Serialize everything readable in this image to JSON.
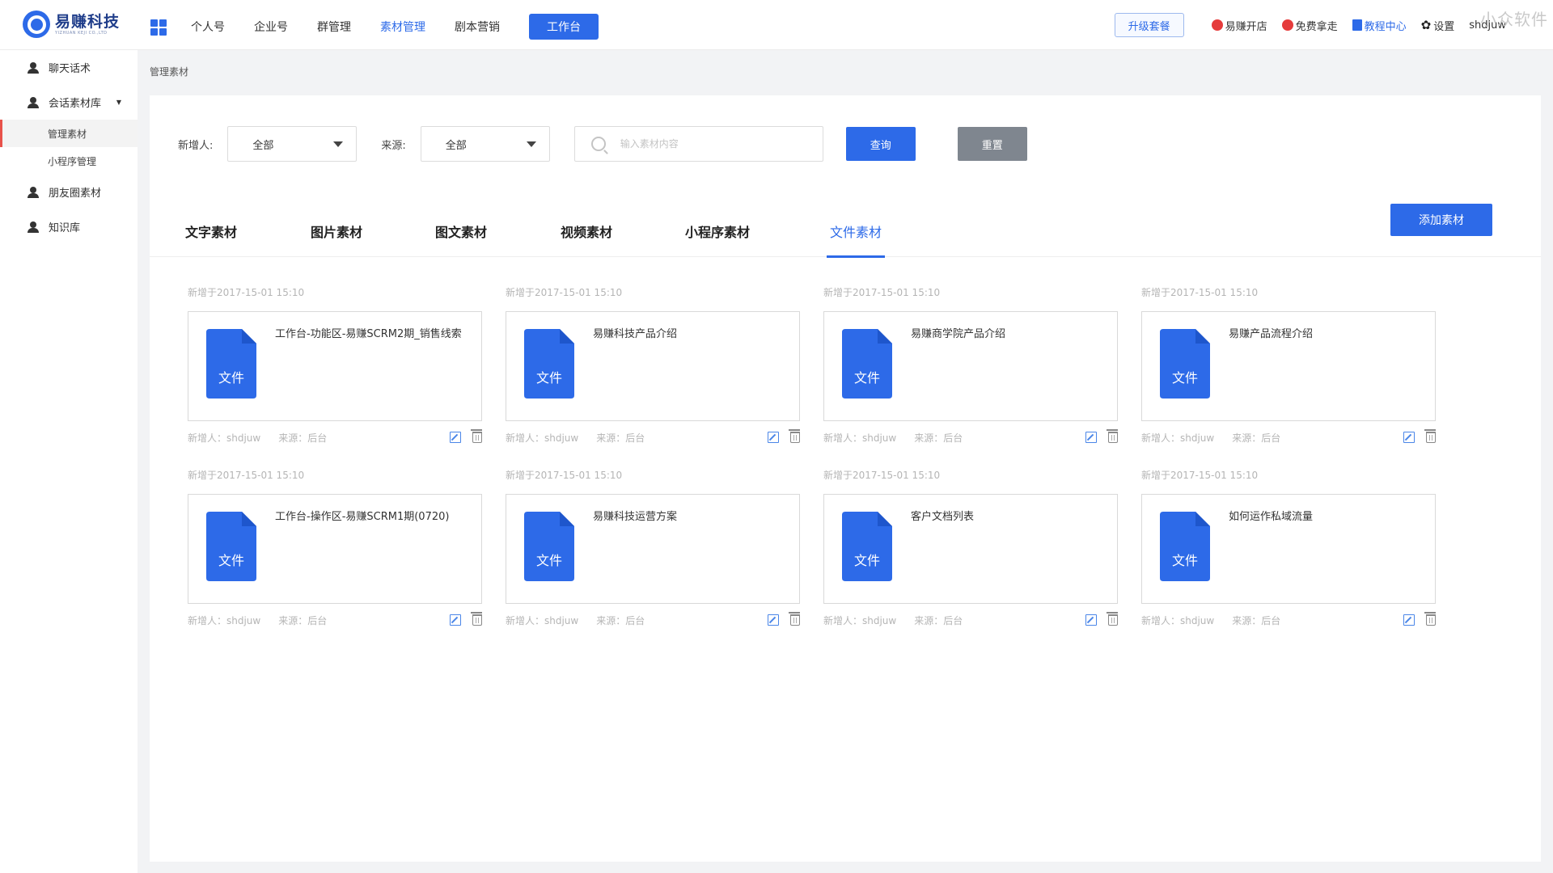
{
  "header": {
    "logo_name": "易赚科技",
    "logo_sub": "YIZHUAN KEJI CO.,LTD",
    "nav": [
      {
        "label": "个人号"
      },
      {
        "label": "企业号"
      },
      {
        "label": "群管理"
      },
      {
        "label": "素材管理",
        "active": true
      },
      {
        "label": "剧本营销"
      }
    ],
    "workbench_label": "工作台",
    "upgrade_label": "升级套餐",
    "tools": {
      "open_store": "易赚开店",
      "free_take": "免费拿走",
      "tutorial": "教程中心",
      "settings": "设置",
      "user": "shdjuw"
    },
    "watermark": "小众软件",
    "accent_color": "#2d6ae8"
  },
  "sidebar": {
    "items": [
      {
        "label": "聊天话术"
      },
      {
        "label": "会话素材库"
      },
      {
        "label": "管理素材"
      },
      {
        "label": "小程序管理"
      },
      {
        "label": "朋友圈素材"
      },
      {
        "label": "知识库"
      }
    ]
  },
  "breadcrumb": "管理素材",
  "filters": {
    "adder_label": "新增人:",
    "adder_value": "全部",
    "source_label": "来源:",
    "source_value": "全部",
    "search_placeholder": "输入素材内容",
    "query_label": "查询",
    "reset_label": "重置"
  },
  "tabs": [
    {
      "label": "文字素材"
    },
    {
      "label": "图片素材"
    },
    {
      "label": "图文素材"
    },
    {
      "label": "视频素材"
    },
    {
      "label": "小程序素材"
    },
    {
      "label": "文件素材",
      "active": true
    }
  ],
  "add_label": "添加素材",
  "cards": [
    {
      "date": "新增于2017-15-01 15:10",
      "icon_text": "文件",
      "title": "工作台-功能区-易赚SCRM2期_销售线索",
      "adder": "新增人：shdjuw",
      "source": "来源：后台"
    },
    {
      "date": "新增于2017-15-01 15:10",
      "icon_text": "文件",
      "title": "易赚科技产品介绍",
      "adder": "新增人：shdjuw",
      "source": "来源：后台"
    },
    {
      "date": "新增于2017-15-01 15:10",
      "icon_text": "文件",
      "title": "易赚商学院产品介绍",
      "adder": "新增人：shdjuw",
      "source": "来源：后台"
    },
    {
      "date": "新增于2017-15-01 15:10",
      "icon_text": "文件",
      "title": "易赚产品流程介绍",
      "adder": "新增人：shdjuw",
      "source": "来源：后台"
    },
    {
      "date": "新增于2017-15-01 15:10",
      "icon_text": "文件",
      "title": "工作台-操作区-易赚SCRM1期(0720)",
      "adder": "新增人：shdjuw",
      "source": "来源：后台"
    },
    {
      "date": "新增于2017-15-01 15:10",
      "icon_text": "文件",
      "title": "易赚科技运营方案",
      "adder": "新增人：shdjuw",
      "source": "来源：后台"
    },
    {
      "date": "新增于2017-15-01 15:10",
      "icon_text": "文件",
      "title": "客户文档列表",
      "adder": "新增人：shdjuw",
      "source": "来源：后台"
    },
    {
      "date": "新增于2017-15-01 15:10",
      "icon_text": "文件",
      "title": "如何运作私域流量",
      "adder": "新增人：shdjuw",
      "source": "来源：后台"
    }
  ]
}
